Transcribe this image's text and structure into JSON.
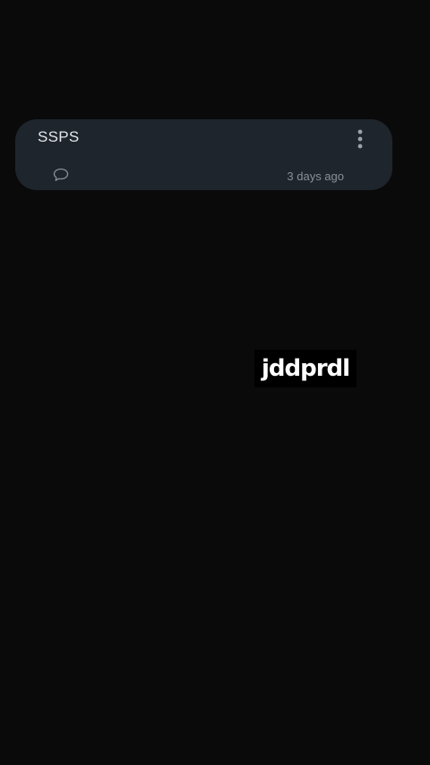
{
  "note_card": {
    "title": "SSPS",
    "timestamp": "3 days ago",
    "menu_icon": "more-vertical-icon",
    "comment_icon": "comment-icon"
  },
  "overlay": {
    "label": "jddprdl"
  },
  "colors": {
    "background": "#0a0a0b",
    "card": "#1f252d",
    "title_text": "#e3e6ea",
    "muted_text": "#8a9099"
  }
}
